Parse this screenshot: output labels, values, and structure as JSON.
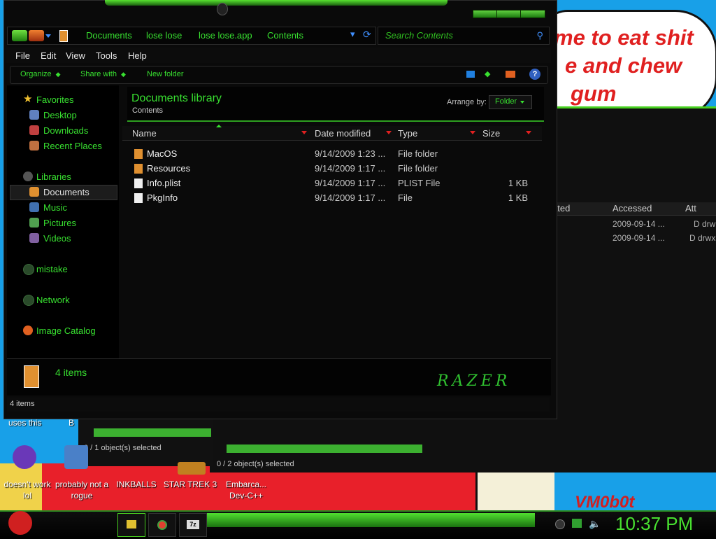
{
  "window": {
    "breadcrumbs": [
      "Documents",
      "lose lose",
      "lose lose.app",
      "Contents"
    ],
    "search_placeholder": "Search Contents",
    "menu": [
      "File",
      "Edit",
      "View",
      "Tools",
      "Help"
    ],
    "commands": [
      "Organize",
      "Share with",
      "New folder"
    ],
    "nav": {
      "favorites_label": "Favorites",
      "favorites": [
        "Desktop",
        "Downloads",
        "Recent Places"
      ],
      "libraries_label": "Libraries",
      "libraries": [
        "Documents",
        "Music",
        "Pictures",
        "Videos"
      ],
      "other": [
        "mistake",
        "Network",
        "Image Catalog"
      ]
    },
    "library": {
      "title": "Documents library",
      "subtitle": "Contents",
      "arrange_label": "Arrange by:",
      "arrange_value": "Folder"
    },
    "columns": [
      "Name",
      "Date modified",
      "Type",
      "Size"
    ],
    "files": [
      {
        "name": "MacOS",
        "date": "9/14/2009 1:23 ...",
        "type": "File folder",
        "size": "",
        "icon": "folder-icon"
      },
      {
        "name": "Resources",
        "date": "9/14/2009 1:17 ...",
        "type": "File folder",
        "size": "",
        "icon": "folder-icon"
      },
      {
        "name": "Info.plist",
        "date": "9/14/2009 1:17 ...",
        "type": "PLIST File",
        "size": "1 KB",
        "icon": "file-icon"
      },
      {
        "name": "PkgInfo",
        "date": "9/14/2009 1:17 ...",
        "type": "File",
        "size": "1 KB",
        "icon": "file-icon"
      }
    ],
    "details_count": "4 items",
    "status": "4 items",
    "brand": "RAZER"
  },
  "background_window": {
    "columns": [
      "ated",
      "Accessed",
      "Att"
    ],
    "rows": [
      {
        "accessed": "2009-09-14 ...",
        "attr": "D drw"
      },
      {
        "accessed": "2009-09-14 ...",
        "attr": "D drwx"
      }
    ],
    "selection": "0 / 2 object(s) selected"
  },
  "small_window": {
    "selection": "0 / 1 object(s) selected"
  },
  "desktop": {
    "note_lines": [
      "me to eat shit",
      "e and chew",
      "gum"
    ],
    "icons": [
      {
        "label": "doesn't work lol"
      },
      {
        "label": "probably not a rogue"
      },
      {
        "label": "INKBALLS"
      },
      {
        "label": "STAR TREK 3"
      },
      {
        "label": "Embarca... Dev-C++"
      }
    ],
    "top_labels": [
      "uses this",
      "B"
    ],
    "signature": "VM0b0t"
  },
  "taskbar": {
    "clock": "10:37 PM"
  },
  "colors": {
    "accent": "#38e030",
    "background": "#0a0a0a",
    "desktop": "#18a0e8"
  }
}
